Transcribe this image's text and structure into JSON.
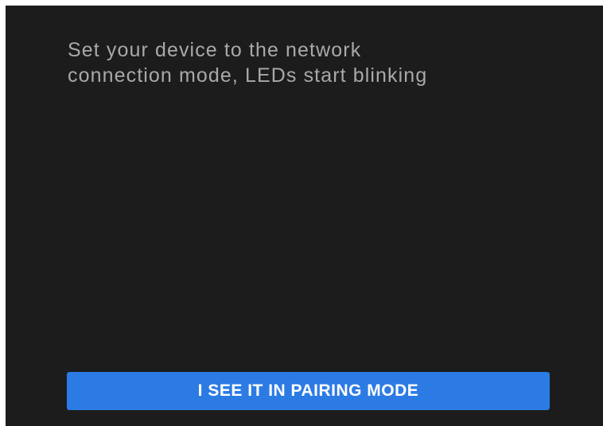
{
  "instruction": {
    "text": "Set your device to the network\nconnection mode, LEDs start blinking"
  },
  "pair_button": {
    "label": "I SEE IT IN PAIRING MODE"
  },
  "colors": {
    "background": "#1c1c1c",
    "text": "#a9a9a9",
    "accent": "#2c7be5"
  }
}
